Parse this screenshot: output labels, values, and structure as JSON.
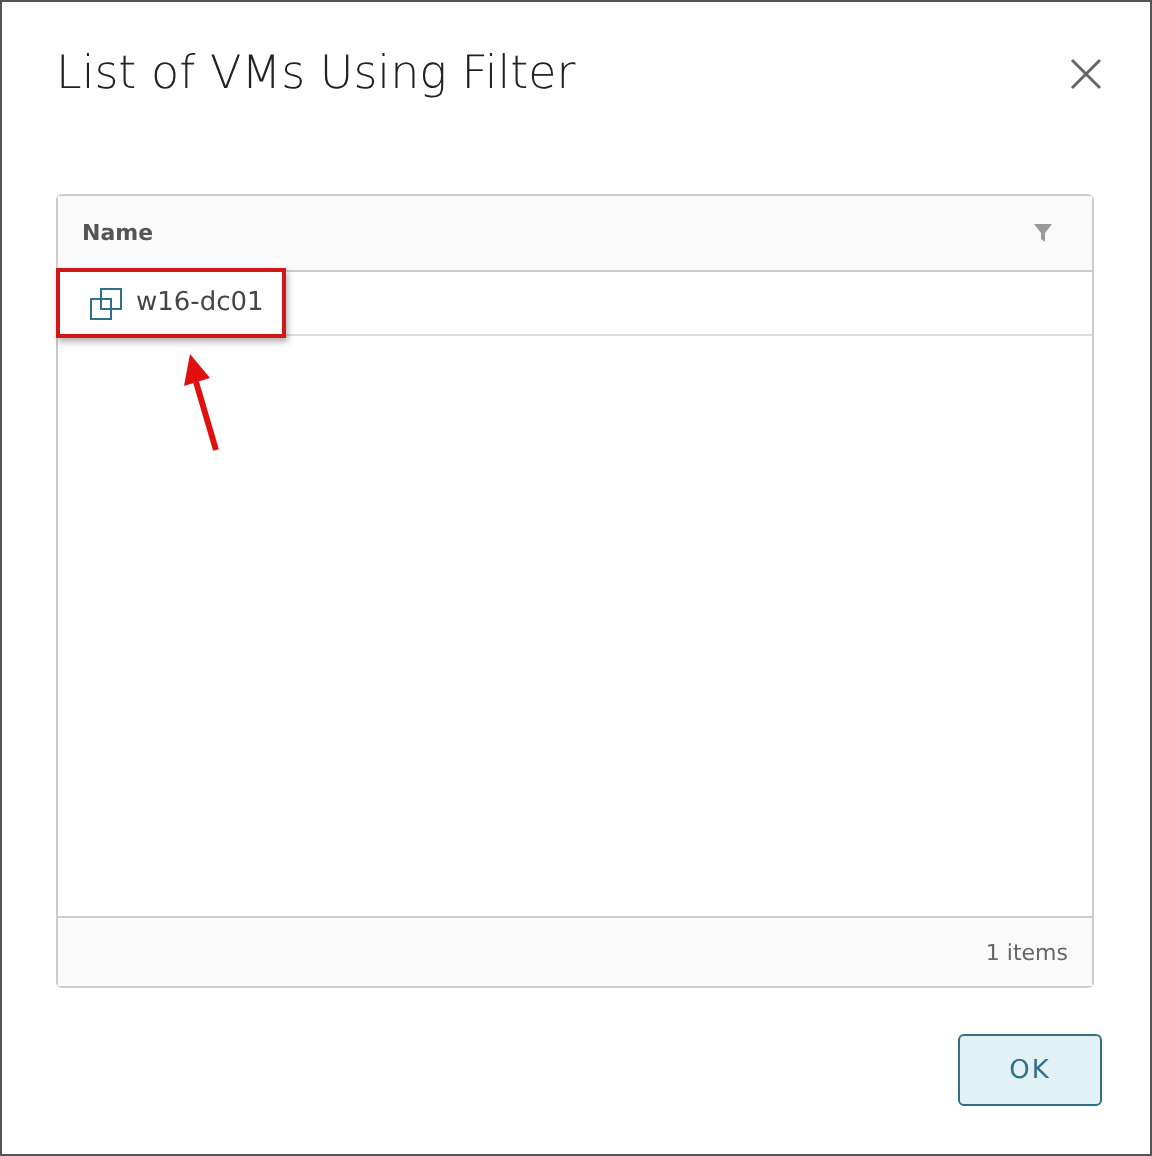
{
  "dialog": {
    "title": "List of VMs Using Filter"
  },
  "table": {
    "columns": [
      "Name"
    ],
    "rows": [
      {
        "name": "w16-dc01",
        "highlighted": true
      }
    ],
    "footer": "1 items"
  },
  "buttons": [
    "OK"
  ]
}
